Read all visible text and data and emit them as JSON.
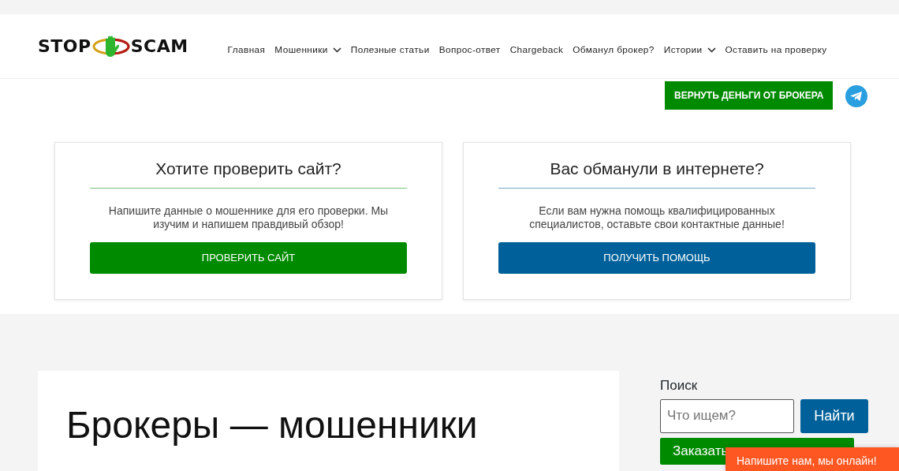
{
  "logo": {
    "left": "STOP",
    "right": "SCAM"
  },
  "nav": [
    {
      "label": "Главная",
      "dropdown": false
    },
    {
      "label": "Мошенники",
      "dropdown": true
    },
    {
      "label": "Полезные статьи",
      "dropdown": false
    },
    {
      "label": "Вопрос-ответ",
      "dropdown": false
    },
    {
      "label": "Chargeback",
      "dropdown": false
    },
    {
      "label": "Обманул брокер?",
      "dropdown": false
    },
    {
      "label": "Истории",
      "dropdown": true
    },
    {
      "label": "Оставить на проверку",
      "dropdown": false
    }
  ],
  "cta_button": "ВЕРНУТЬ ДЕНЬГИ ОТ БРОКЕРА",
  "promo_cards": [
    {
      "title": "Хотите проверить сайт?",
      "text": "Напишите данные о мошеннике для его проверки. Мы изучим и напишем правдивый обзор!",
      "button": "ПРОВЕРИТЬ САЙТ",
      "color": "#008a00"
    },
    {
      "title": "Вас обманули в интернете?",
      "text": "Если вам нужна помощь квалифицированных специалистов, оставьте свои контактные данные!",
      "button": "ПОЛУЧИТЬ ПОМОЩЬ",
      "color": "#00619a"
    }
  ],
  "article": {
    "title": "Брокеры — мошенники"
  },
  "sidebar": {
    "search_label": "Поиск",
    "search_placeholder": "Что ищем?",
    "search_button": "Найти",
    "order_button": "Заказать"
  },
  "chat_widget": "Напишите нам, мы онлайн!"
}
